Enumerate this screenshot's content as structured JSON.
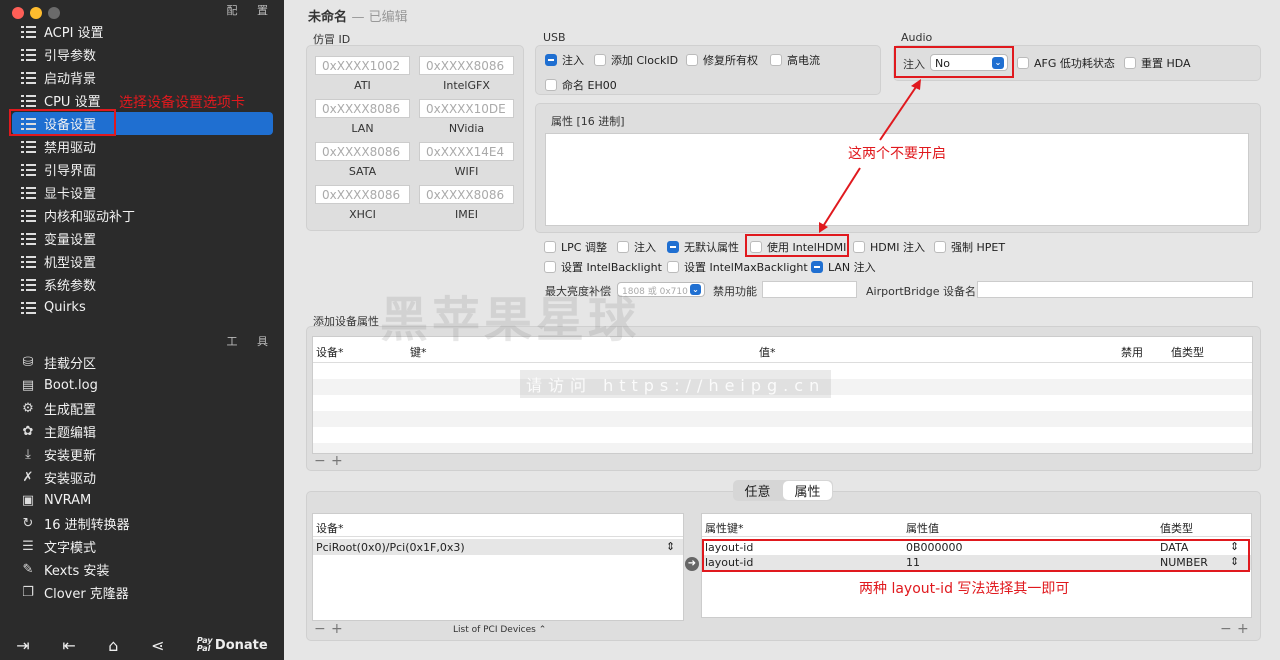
{
  "sidebar": {
    "config_title": "配 置",
    "tools_title": "工 具",
    "items": [
      {
        "label": "ACPI 设置",
        "icon": "list-icon"
      },
      {
        "label": "引导参数",
        "icon": "list-icon"
      },
      {
        "label": "启动背景",
        "icon": "list-icon"
      },
      {
        "label": "CPU 设置",
        "icon": "list-icon"
      },
      {
        "label": "设备设置",
        "icon": "list-icon",
        "selected": true
      },
      {
        "label": "禁用驱动",
        "icon": "list-icon"
      },
      {
        "label": "引导界面",
        "icon": "list-icon"
      },
      {
        "label": "显卡设置",
        "icon": "list-icon"
      },
      {
        "label": "内核和驱动补丁",
        "icon": "list-icon"
      },
      {
        "label": "变量设置",
        "icon": "list-icon"
      },
      {
        "label": "机型设置",
        "icon": "list-icon"
      },
      {
        "label": "系统参数",
        "icon": "list-icon"
      },
      {
        "label": "Quirks",
        "icon": "list-icon"
      }
    ],
    "tools": [
      {
        "label": "挂载分区",
        "icon": "disk-icon"
      },
      {
        "label": "Boot.log",
        "icon": "document-icon"
      },
      {
        "label": "生成配置",
        "icon": "gears-icon"
      },
      {
        "label": "主题编辑",
        "icon": "palette-icon"
      },
      {
        "label": "安装更新",
        "icon": "download-icon"
      },
      {
        "label": "安装驱动",
        "icon": "wrench-icon"
      },
      {
        "label": "NVRAM",
        "icon": "chip-icon"
      },
      {
        "label": "16 进制转换器",
        "icon": "refresh-icon"
      },
      {
        "label": "文字模式",
        "icon": "text-icon"
      },
      {
        "label": "Kexts 安装",
        "icon": "puzzle-icon"
      },
      {
        "label": "Clover 克隆器",
        "icon": "copy-icon"
      }
    ],
    "bottom": {
      "donate": "Donate",
      "paypal": "Pay Pal"
    }
  },
  "window": {
    "title": "未命名",
    "edited": "— 已编辑"
  },
  "fake_id": {
    "title": "仿冒 ID",
    "fields": [
      {
        "placeholder": "0xXXXX1002",
        "caption": "ATI"
      },
      {
        "placeholder": "0xXXXX8086",
        "caption": "IntelGFX"
      },
      {
        "placeholder": "0xXXXX8086",
        "caption": "LAN"
      },
      {
        "placeholder": "0xXXXX10DE",
        "caption": "NVidia"
      },
      {
        "placeholder": "0xXXXX8086",
        "caption": "SATA"
      },
      {
        "placeholder": "0xXXXX14E4",
        "caption": "WIFI"
      },
      {
        "placeholder": "0xXXXX8086",
        "caption": "XHCI"
      },
      {
        "placeholder": "0xXXXX8086",
        "caption": "IMEI"
      }
    ]
  },
  "usb": {
    "title": "USB",
    "inject": "注入",
    "add_clockid": "添加 ClockID",
    "fix_ownership": "修复所有权",
    "high_current": "高电流",
    "name_eh00": "命名 EH00"
  },
  "audio": {
    "title": "Audio",
    "inject_label": "注入",
    "inject_value": "No",
    "afg": "AFG 低功耗状态",
    "reset_hda": "重置 HDA"
  },
  "properties": {
    "title": "属性 [16 进制]"
  },
  "options": {
    "lpc": "LPC 调整",
    "inject": "注入",
    "no_default": "无默认属性",
    "use_intelhdmi": "使用 IntelHDMI",
    "hdmi_inject": "HDMI 注入",
    "force_hpet": "强制 HPET",
    "set_backlight": "设置 IntelBacklight",
    "set_maxbacklight": "设置 IntelMaxBacklight",
    "lan_inject": "LAN 注入",
    "max_brightness": "最大亮度补偿",
    "brightness_placeholder": "1808 或 0x710",
    "disable_func": "禁用功能",
    "airport": "AirportBridge 设备名"
  },
  "add_props": {
    "title": "添加设备属性",
    "headers": [
      "设备*",
      "键*",
      "值*",
      "禁用",
      "值类型"
    ]
  },
  "tabs": {
    "left": "任意",
    "right": "属性"
  },
  "devices": {
    "header": "设备*",
    "row": "PciRoot(0x0)/Pci(0x1F,0x3)",
    "footer": "List of PCI Devices"
  },
  "prop_table": {
    "headers": [
      "属性键*",
      "属性值",
      "值类型"
    ],
    "rows": [
      {
        "key": "layout-id",
        "value": "0B000000",
        "type": "DATA"
      },
      {
        "key": "layout-id",
        "value": "11",
        "type": "NUMBER"
      }
    ]
  },
  "annotations": {
    "select_tab": "选择设备设置选项卡",
    "dont_enable": "这两个不要开启",
    "layout_note": "两种 layout-id 写法选择其一即可"
  },
  "watermark": {
    "main": "黑苹果星球",
    "url": "请访问 https://heipg.cn"
  },
  "colors": {
    "accent": "#1f6fd1",
    "annotation": "#e0191e",
    "sidebar": "#2b2b2b"
  }
}
